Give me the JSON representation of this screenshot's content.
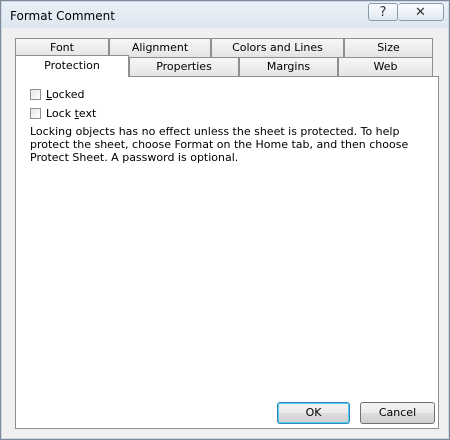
{
  "window": {
    "title": "Format Comment"
  },
  "titlebar": {
    "help_label": "?",
    "close_label": "✕"
  },
  "tabs": {
    "row1": [
      "Font",
      "Alignment",
      "Colors and Lines",
      "Size"
    ],
    "row2": [
      "Protection",
      "Properties",
      "Margins",
      "Web"
    ],
    "active": "Protection"
  },
  "protection": {
    "locked": {
      "label": "Locked",
      "underline": "L",
      "checked": false
    },
    "lock_text": {
      "label": "Lock text",
      "underline": "t",
      "checked": false
    },
    "note": "Locking objects has no effect unless the sheet is protected.  To help protect the sheet, choose Format on the Home tab, and then choose Protect Sheet.  A password is optional."
  },
  "buttons": {
    "ok_label": "OK",
    "cancel_label": "Cancel"
  }
}
